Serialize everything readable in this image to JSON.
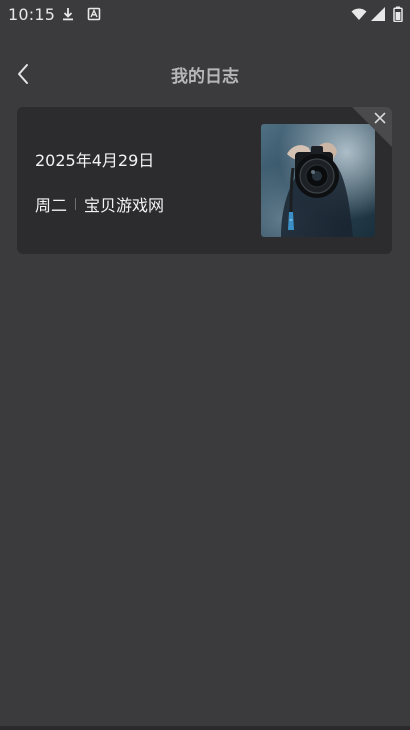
{
  "status_bar": {
    "time": "10:15",
    "icons": [
      "download-icon",
      "app-icon",
      "wifi-icon",
      "signal-icon",
      "battery-icon"
    ]
  },
  "header": {
    "title": "我的日志",
    "back_icon": "chevron-left-icon"
  },
  "journal_entries": [
    {
      "date": "2025年4月29日",
      "weekday": "周二",
      "source": "宝贝游戏网",
      "photo": "photographer-holding-camera",
      "delete_icon": "close-icon"
    }
  ],
  "colors": {
    "background": "#3b3a3c",
    "card": "#2c2b2d",
    "title": "#b7b6b8",
    "text": "#f3f3f3"
  }
}
